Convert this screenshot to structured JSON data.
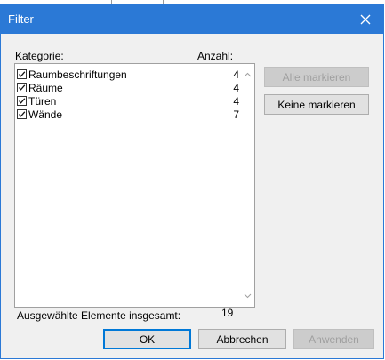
{
  "window": {
    "title": "Filter",
    "close_glyph": "✕"
  },
  "headers": {
    "category": "Kategorie:",
    "count": "Anzahl:"
  },
  "categories": [
    {
      "name": "Raumbeschriftungen",
      "count": "4",
      "checked": true
    },
    {
      "name": "Räume",
      "count": "4",
      "checked": true
    },
    {
      "name": "Türen",
      "count": "4",
      "checked": true
    },
    {
      "name": "Wände",
      "count": "7",
      "checked": true
    }
  ],
  "buttons": {
    "check_all": "Alle markieren",
    "check_none": "Keine markieren",
    "ok": "OK",
    "cancel": "Abbrechen",
    "apply": "Anwenden"
  },
  "total": {
    "label": "Ausgewählte Elemente insgesamt:",
    "value": "19"
  },
  "colors": {
    "titlebar": "#2b79d6",
    "accent": "#0078d7"
  },
  "icons": {
    "close": "close-icon",
    "checkbox": "checkmark-icon",
    "scroll_up": "chevron-up-icon",
    "scroll_down": "chevron-down-icon"
  }
}
